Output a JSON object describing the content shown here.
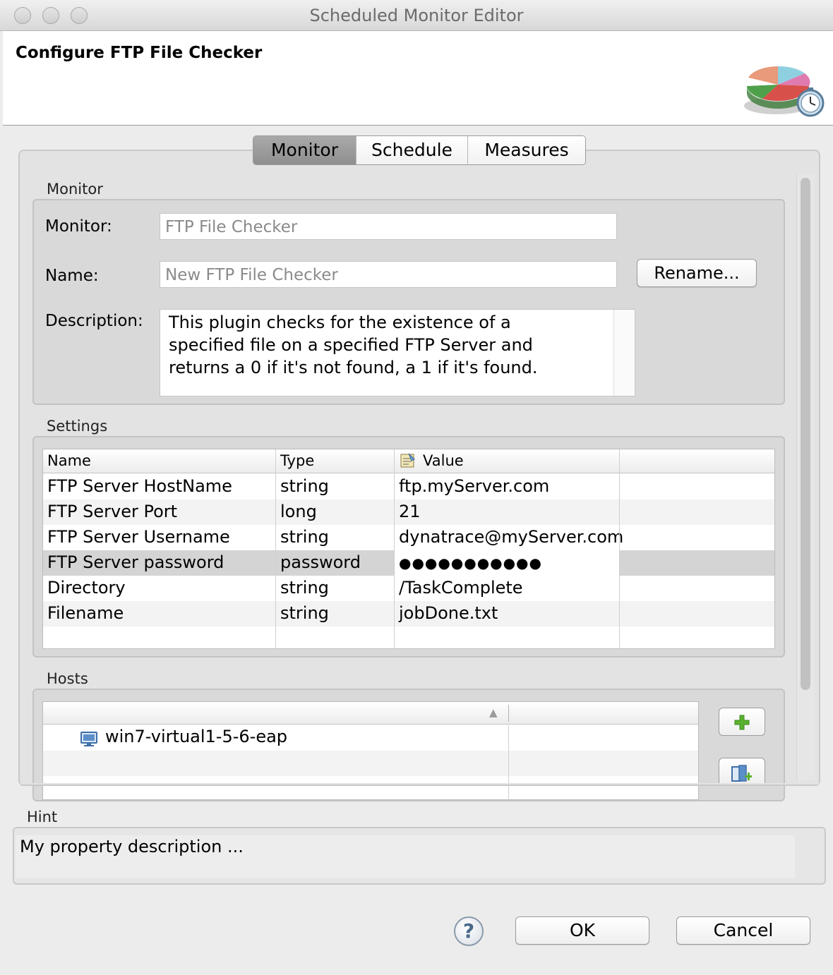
{
  "window": {
    "title": "Scheduled Monitor Editor"
  },
  "header": {
    "title": "Configure FTP File Checker",
    "logo_icon": "monitor-chart-clock-icon"
  },
  "tabs": [
    {
      "label": "Monitor",
      "active": true
    },
    {
      "label": "Schedule",
      "active": false
    },
    {
      "label": "Measures",
      "active": false
    }
  ],
  "monitor_section": {
    "label": "Monitor",
    "monitor_label": "Monitor:",
    "monitor_value": "FTP File Checker",
    "name_label": "Name:",
    "name_value": "New FTP File Checker",
    "rename_button": "Rename...",
    "description_label": "Description:",
    "description_lines": [
      "This plugin checks for the existence of a",
      "specified file on a specified FTP Server and",
      "returns a 0 if it's not found, a 1 if it's found."
    ]
  },
  "settings_section": {
    "label": "Settings",
    "columns": [
      "Name",
      "Type",
      "Value"
    ],
    "value_column_icon": "properties-icon",
    "rows": [
      {
        "name": "FTP Server HostName",
        "type": "string",
        "value": "ftp.myServer.com"
      },
      {
        "name": "FTP Server Port",
        "type": "long",
        "value": "21"
      },
      {
        "name": "FTP Server Username",
        "type": "string",
        "value": "dynatrace@myServer.com"
      },
      {
        "name": "FTP Server password",
        "type": "password",
        "value": "●●●●●●●●●●●",
        "selected": true
      },
      {
        "name": "Directory",
        "type": "string",
        "value": "/TaskComplete"
      },
      {
        "name": "Filename",
        "type": "string",
        "value": "jobDone.txt"
      }
    ]
  },
  "hosts_section": {
    "label": "Hosts",
    "sort_indicator": "▲",
    "rows": [
      {
        "name": "win7-virtual1-5-6-eap",
        "icon": "computer-icon"
      }
    ],
    "add_icon": "add-plus-icon",
    "remove_icon": "remove-host-icon"
  },
  "hint": {
    "label": "Hint",
    "text": "My property description ..."
  },
  "footer": {
    "help_icon": "help-icon",
    "help_glyph": "?",
    "ok_button": "OK",
    "cancel_button": "Cancel"
  },
  "colors": {
    "selected_row": "#d4d4d4",
    "active_tab": "#9a9a9a",
    "add_icon_green": "#5bb12f"
  }
}
